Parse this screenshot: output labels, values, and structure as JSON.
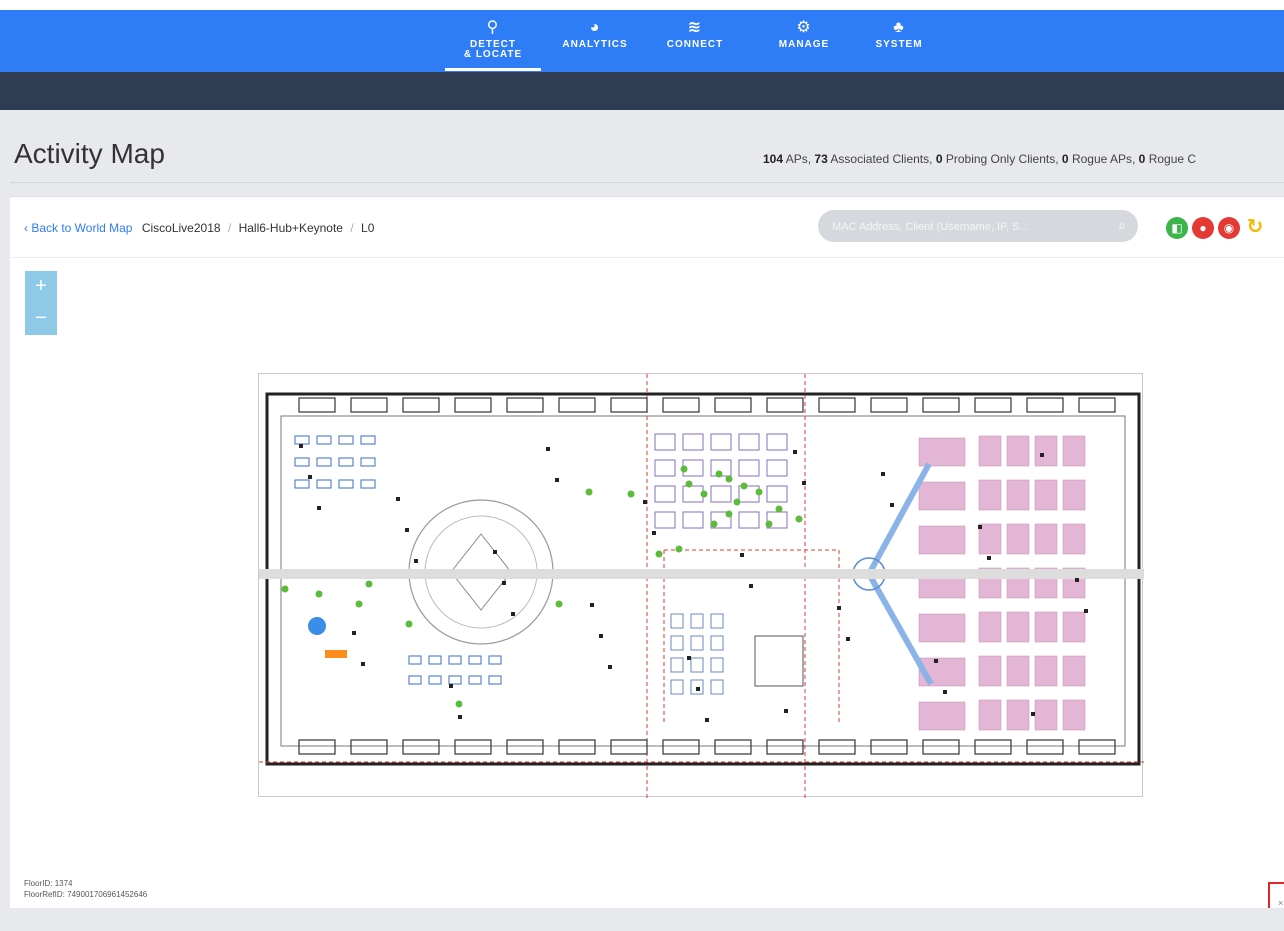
{
  "nav": {
    "items": [
      {
        "icon": "location-pin-icon",
        "glyph": "⚲",
        "label": "DETECT\n& LOCATE",
        "active": true
      },
      {
        "icon": "dashboard-gauge-icon",
        "glyph": "◕",
        "label": "ANALYTICS"
      },
      {
        "icon": "wifi-icon",
        "glyph": "≋",
        "label": "CONNECT"
      },
      {
        "icon": "gears-icon",
        "glyph": "⚙",
        "label": "MANAGE"
      },
      {
        "icon": "hierarchy-icon",
        "glyph": "♣",
        "label": "SYSTEM"
      }
    ]
  },
  "page": {
    "title": "Activity Map"
  },
  "stats": {
    "aps": "104",
    "aps_label": "APs,",
    "associated": "73",
    "associated_label": "Associated Clients,",
    "probing": "0",
    "probing_label": "Probing Only Clients,",
    "rogue_aps": "0",
    "rogue_aps_label": "Rogue APs,",
    "rogue_clients": "0",
    "rogue_clients_label": "Rogue C"
  },
  "breadcrumb": {
    "back": "‹ Back to World Map",
    "campus": "CiscoLive2018",
    "building": "Hall6-Hub+Keynote",
    "floor": "L0"
  },
  "search": {
    "placeholder": "MAC Address, Client (Username, IP, S...",
    "value": ""
  },
  "toolbar": {
    "buttons": [
      {
        "icon": "client-green-icon",
        "glyph": "◧",
        "color": "#3bb44a"
      },
      {
        "icon": "user-red-icon",
        "glyph": "●",
        "color": "#e53935"
      },
      {
        "icon": "rogue-red-icon",
        "glyph": "◉",
        "color": "#e53935"
      },
      {
        "icon": "refresh-yellow-icon",
        "glyph": "↻",
        "color": "#f5b800"
      }
    ]
  },
  "zoom": {
    "in": "+",
    "out": "−"
  },
  "floor": {
    "floor_id_label": "FloorID:",
    "floor_id": "1374",
    "floor_ref_label": "FloorRefID:",
    "floor_ref": "749001706961452646"
  },
  "close": {
    "label": "×"
  },
  "colors": {
    "nav": "#2f7df6",
    "subbar": "#2e3c54",
    "accent": "#2f7df6",
    "client_dot": "#5dbb3c",
    "seating": "#e3b6d6"
  }
}
